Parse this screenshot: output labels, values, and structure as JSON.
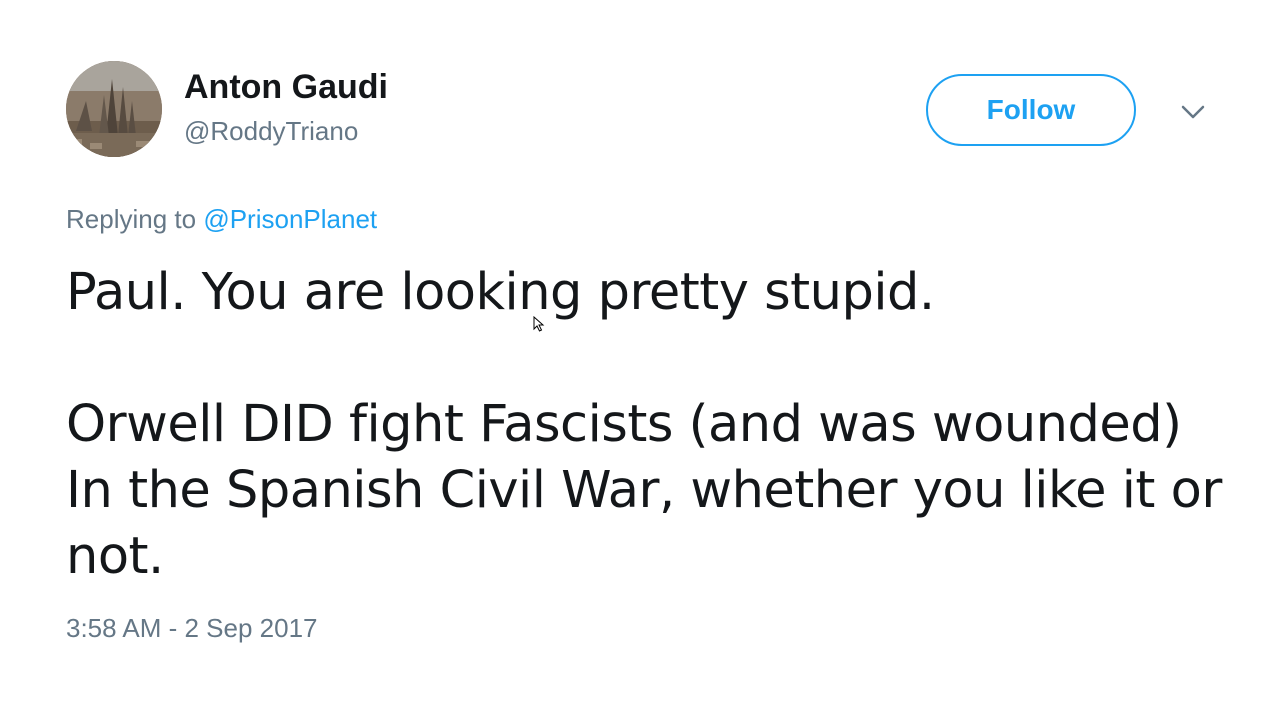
{
  "author": {
    "name": "Anton Gaudi",
    "handle": "@RoddyTriano"
  },
  "actions": {
    "follow_label": "Follow"
  },
  "reply": {
    "prefix": "Replying to",
    "target": "@PrisonPlanet"
  },
  "tweet": {
    "paragraphs": [
      "Paul. You are looking pretty stupid.",
      "Orwell DID fight Fascists (and was wounded) In the Spanish Civil War, whether you like it or not."
    ],
    "timestamp": "3:58 AM - 2 Sep 2017"
  },
  "icons": {
    "menu": "chevron-down-icon",
    "cursor": "mouse-pointer-icon"
  },
  "colors": {
    "accent": "#1da1f2",
    "secondary_text": "#657786",
    "primary_text": "#14171a"
  }
}
